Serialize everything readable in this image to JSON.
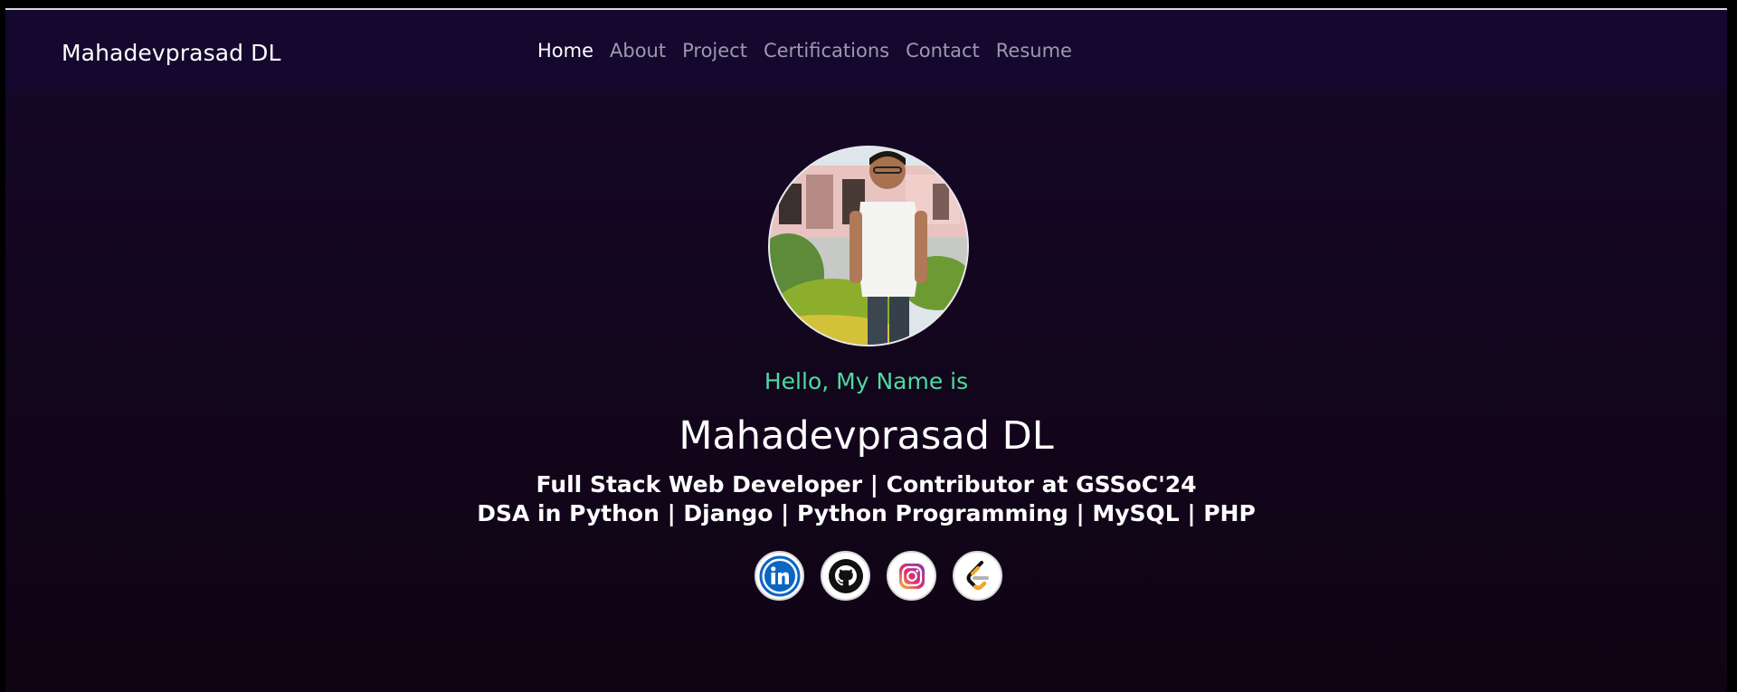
{
  "navbar": {
    "brand": "Mahadevprasad DL",
    "links": [
      {
        "label": "Home",
        "active": true
      },
      {
        "label": "About",
        "active": false
      },
      {
        "label": "Project",
        "active": false
      },
      {
        "label": "Certifications",
        "active": false
      },
      {
        "label": "Contact",
        "active": false
      },
      {
        "label": "Resume",
        "active": false
      }
    ]
  },
  "hero": {
    "greeting": "Hello, My Name is",
    "name": "Mahadevprasad DL",
    "tagline_1": "Full Stack Web Developer | Contributor at GSSoC'24",
    "tagline_2": "DSA in Python | Django | Python Programming | MySQL | PHP"
  },
  "socials": [
    {
      "icon": "linkedin-icon"
    },
    {
      "icon": "github-icon"
    },
    {
      "icon": "instagram-icon"
    },
    {
      "icon": "leetcode-icon"
    }
  ],
  "colors": {
    "greeting": "#4fdaa0",
    "nav_active": "#ffffff",
    "nav_inactive": "#9d98ad",
    "navbar_bg": "#14082e",
    "page_bg": "#13061f"
  }
}
